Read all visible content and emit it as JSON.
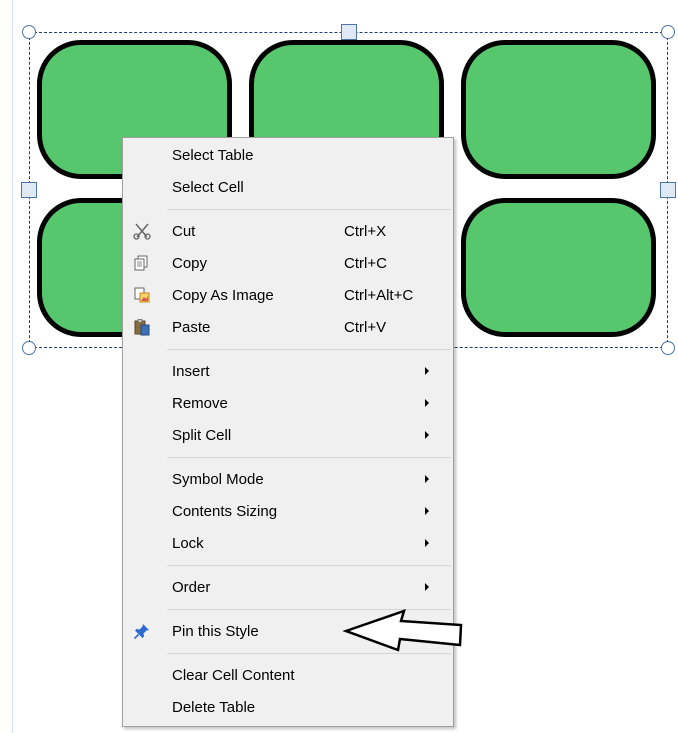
{
  "context_menu": {
    "items": [
      {
        "label": "Select Table"
      },
      {
        "label": "Select Cell"
      },
      {
        "label": "Cut",
        "shortcut": "Ctrl+X",
        "icon": "scissors-icon"
      },
      {
        "label": "Copy",
        "shortcut": "Ctrl+C",
        "icon": "copy-icon"
      },
      {
        "label": "Copy As Image",
        "shortcut": "Ctrl+Alt+C",
        "icon": "copy-as-image-icon"
      },
      {
        "label": "Paste",
        "shortcut": "Ctrl+V",
        "icon": "paste-icon"
      },
      {
        "label": "Insert",
        "submenu": true
      },
      {
        "label": "Remove",
        "submenu": true
      },
      {
        "label": "Split Cell",
        "submenu": true
      },
      {
        "label": "Symbol Mode",
        "submenu": true
      },
      {
        "label": "Contents Sizing",
        "submenu": true
      },
      {
        "label": "Lock",
        "submenu": true
      },
      {
        "label": "Order",
        "submenu": true
      },
      {
        "label": "Pin this Style",
        "icon": "pushpin-icon"
      },
      {
        "label": "Clear Cell Content"
      },
      {
        "label": "Delete Table"
      }
    ]
  },
  "colors": {
    "cell_fill": "#56c76c",
    "cell_border": "#000000",
    "menu_background": "#f0f0f0",
    "selection_border": "#1f3f73"
  }
}
